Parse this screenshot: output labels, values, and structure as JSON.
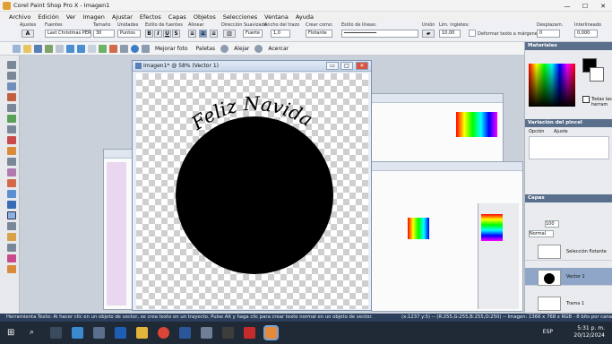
{
  "window": {
    "title": "Corel Paint Shop Pro X - Imagen1",
    "minimize": "—",
    "maximize": "☐",
    "close": "✕"
  },
  "menu": [
    "Archivo",
    "Edición",
    "Ver",
    "Imagen",
    "Ajustar",
    "Efectos",
    "Capas",
    "Objetos",
    "Selecciones",
    "Ventana",
    "Ayuda"
  ],
  "options": {
    "presets_label": "Ajustes",
    "font_label": "Fuentes",
    "font_value": "Last Christmas PER",
    "size_label": "Tamaño",
    "size_value": "30",
    "units_label": "Unidades",
    "units_value": "Puntos",
    "style_label": "Estilo de fuentes",
    "bold": "B",
    "italic": "I",
    "underline": "U",
    "strike": "S",
    "align_label": "Alinear",
    "direction_label": "Dirección",
    "antialias_label": "Suavizado",
    "antialias_value": "Fuerte",
    "stroke_label": "Ancho del trazo",
    "stroke_value": "1,0",
    "create_label": "Crear como:",
    "create_value": "Flotante",
    "line_style_label": "Estilo de líneas:",
    "join_label": "Unión",
    "miter_label": "Lím. ingletes:",
    "miter_value": "10,00",
    "warp_label": "Deformar texto a márgenes",
    "kern_label": "Desplazam.",
    "kern_value": "0",
    "leading_label": "Interlineado",
    "leading_value": "0,000"
  },
  "toolbar": {
    "enhance": "Mejorar foto",
    "palettes": "Paletas",
    "zoom_out": "Alejar",
    "zoom_in": "Acercar"
  },
  "image_window": {
    "title": "Imagen1* @  58% (Vector 1)",
    "min": "▭",
    "max": "□",
    "close": "✕"
  },
  "canvas_text": "Feliz Navidad",
  "bg_window_title": "Imagen1",
  "panels": {
    "materials": "Materiales",
    "all_tools": "Todas las herram",
    "brush_variance": "Variación del pincel",
    "brush_cols": [
      "Opción",
      "Ajuste"
    ],
    "layers": "Capas",
    "opacity": "100",
    "blend": "Normal",
    "layer_names": [
      "Selección flotante",
      "Vector 1",
      "Trama 1"
    ]
  },
  "status": {
    "left": "Herramienta Texto: Al hacer clic en un objeto de vector, se crea texto en un trayecto. Pulse Alt y haga clic para crear texto normal en un objeto de vector.",
    "right": "(x:1237 y:5) -- (R:255,G:255,B:255,O:250) -- Imagen:  1366 x 768 x RGB - 8 bits por canal"
  },
  "clock": {
    "time": "5:31 p. m.",
    "date": "20/12/2024",
    "lang": "ESP"
  },
  "colors": {
    "accent": "#2b3f5c",
    "panel_header": "#5a6f8c"
  }
}
